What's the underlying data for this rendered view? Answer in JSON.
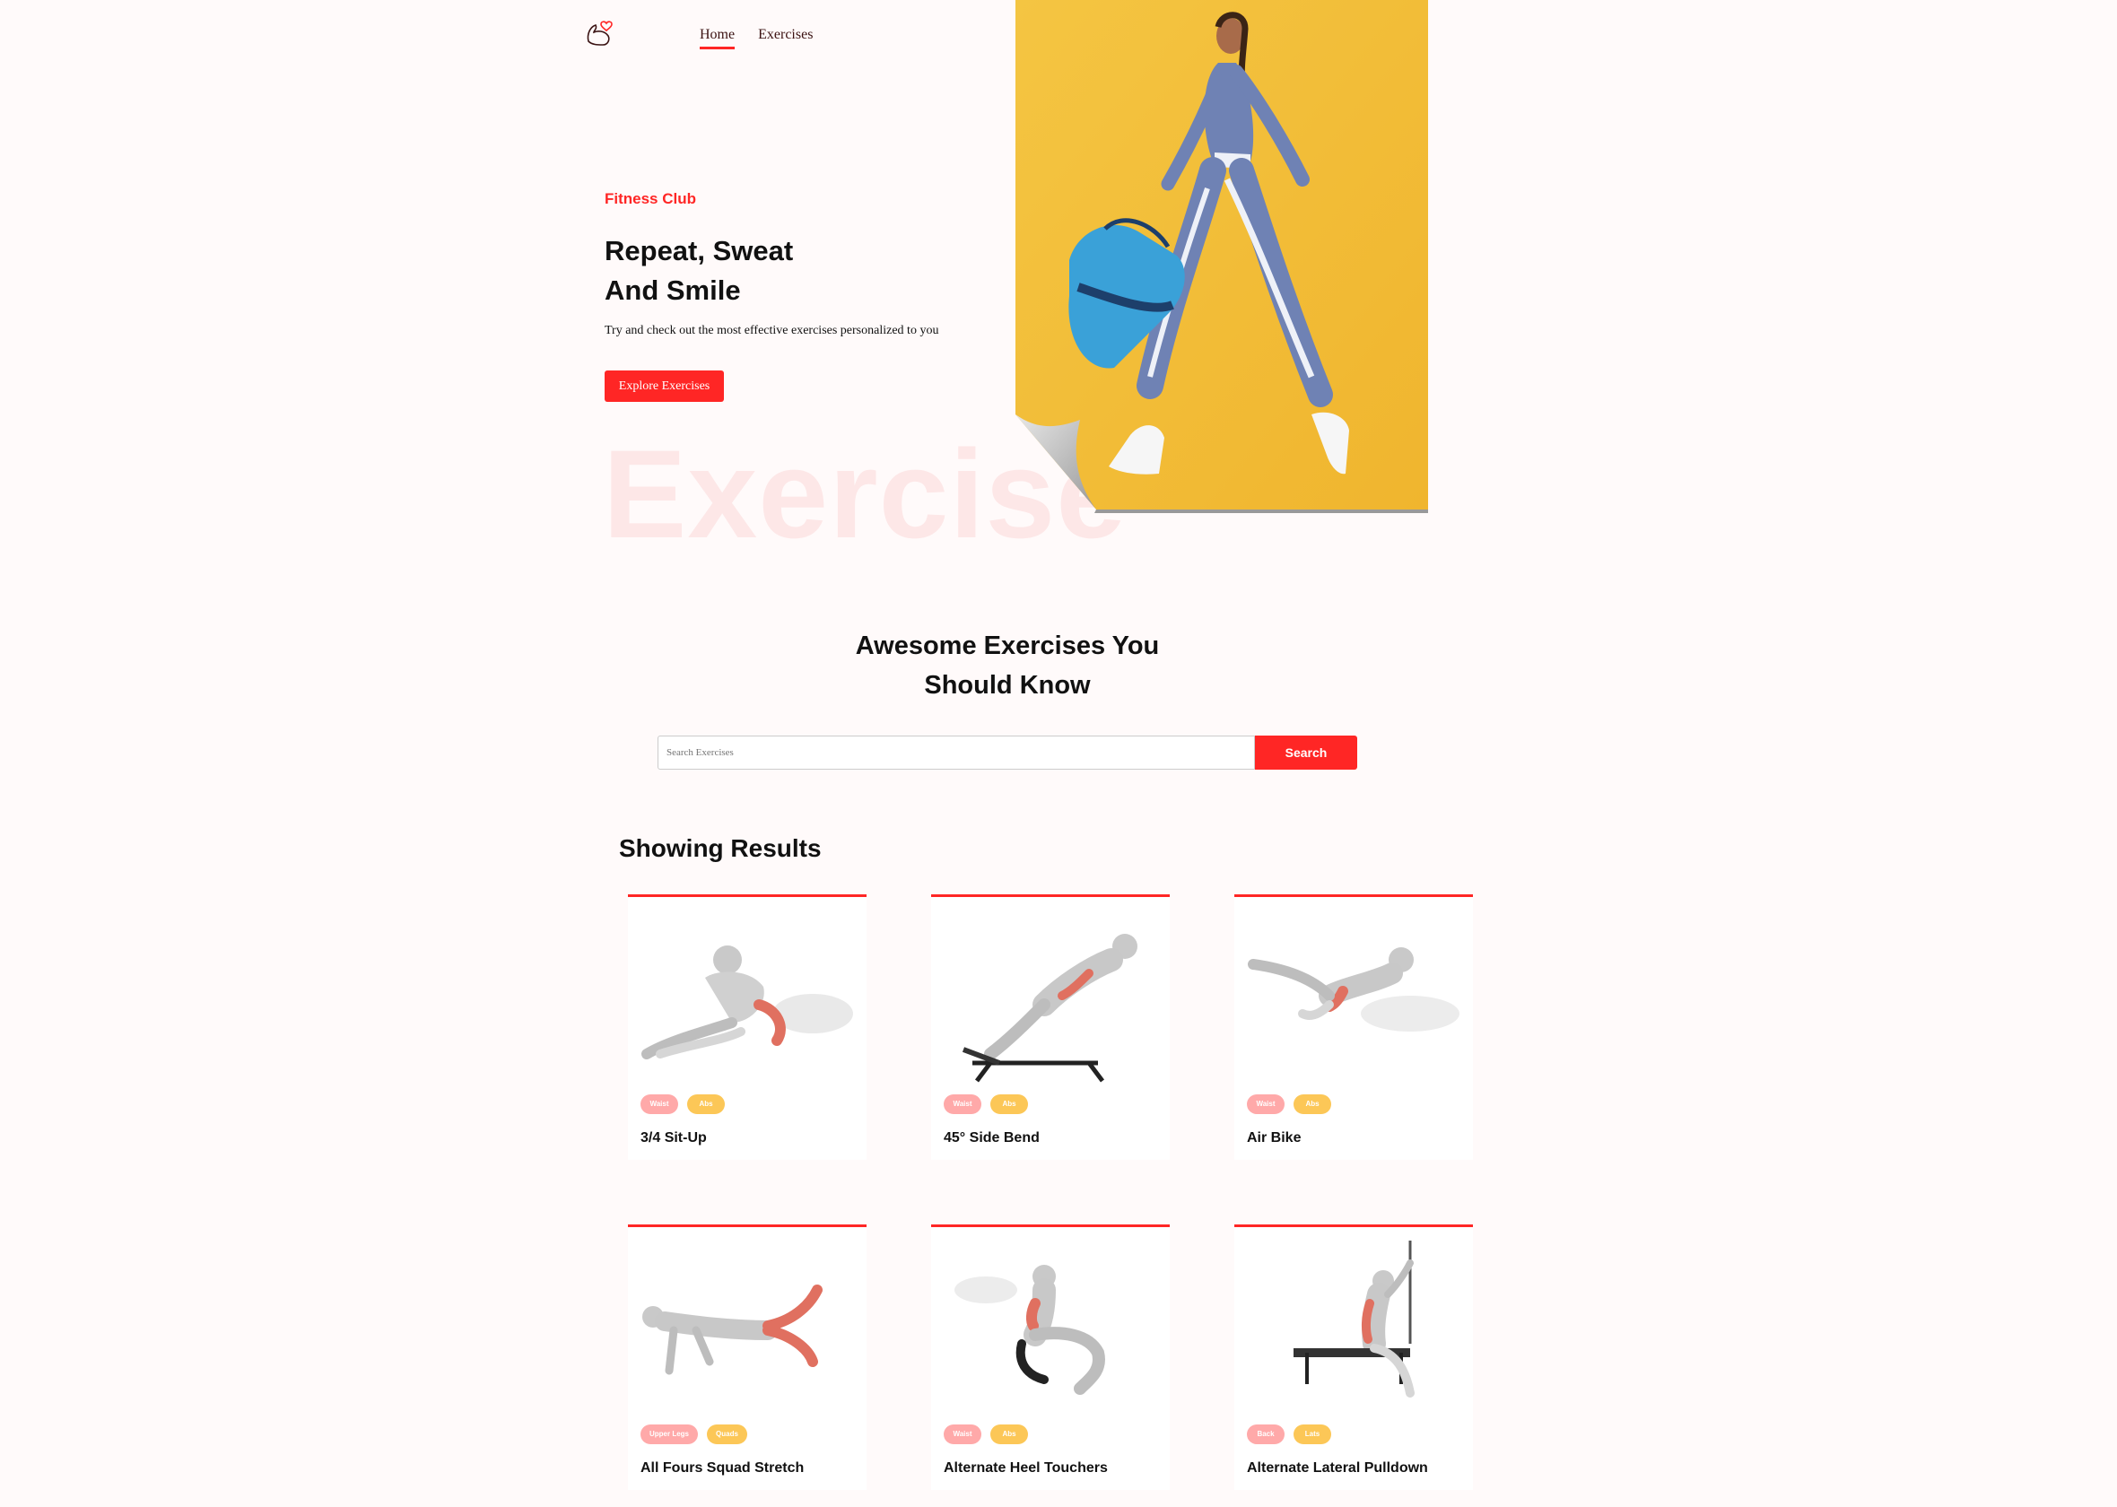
{
  "nav": {
    "home": "Home",
    "exercises": "Exercises"
  },
  "hero": {
    "kicker": "Fitness Club",
    "title_line1": "Repeat, Sweat",
    "title_line2": "And Smile",
    "subtitle": "Try and check out the most effective exercises personalized to you",
    "button": "Explore Exercises",
    "watermark": "Exercise"
  },
  "search": {
    "title_line1": "Awesome Exercises You",
    "title_line2": "Should Know",
    "placeholder": "Search Exercises",
    "button": "Search"
  },
  "results": {
    "title": "Showing Results",
    "cards": [
      {
        "tag1": "Waist",
        "tag2": "Abs",
        "name": "3/4 Sit-Up"
      },
      {
        "tag1": "Waist",
        "tag2": "Abs",
        "name": "45° Side Bend"
      },
      {
        "tag1": "Waist",
        "tag2": "Abs",
        "name": "Air Bike"
      },
      {
        "tag1": "Upper Legs",
        "tag2": "Quads",
        "name": "All Fours Squad Stretch"
      },
      {
        "tag1": "Waist",
        "tag2": "Abs",
        "name": "Alternate Heel Touchers"
      },
      {
        "tag1": "Back",
        "tag2": "Lats",
        "name": "Alternate Lateral Pulldown"
      }
    ]
  }
}
